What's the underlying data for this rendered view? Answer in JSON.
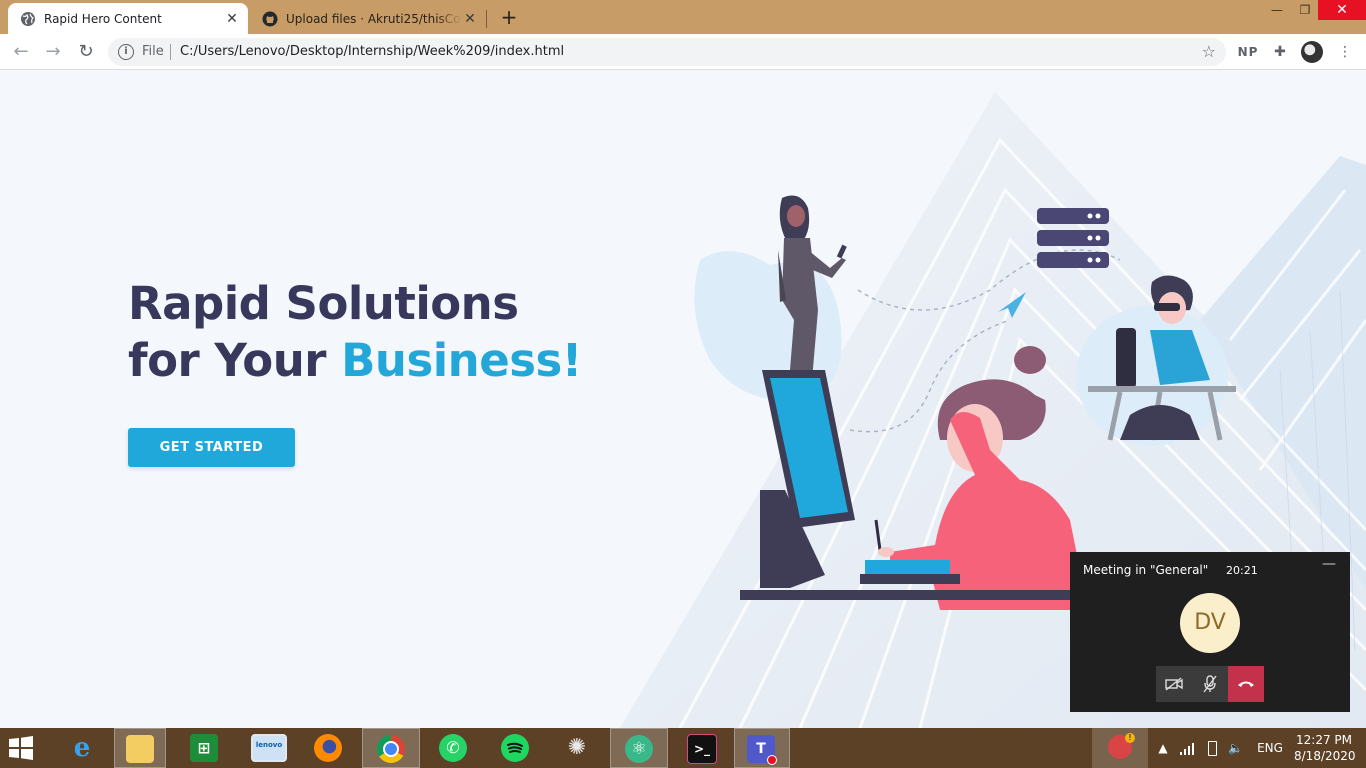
{
  "browser": {
    "tabs": [
      {
        "title": "Rapid Hero Content",
        "favicon": "globe-icon"
      },
      {
        "title": "Upload files · Akruti25/thisCourse",
        "favicon": "github-icon"
      }
    ],
    "new_tab": "+",
    "omnibox": {
      "scheme": "File",
      "url": "C:/Users/Lenovo/Desktop/Internship/Week%209/index.html"
    },
    "profile_initials": "NP"
  },
  "hero": {
    "title_line1": "Rapid Solutions",
    "title_line2_prefix": "for Your ",
    "title_line2_accent": "Business!",
    "cta_label": "GET STARTED"
  },
  "meeting": {
    "title": "Meeting in \"General\"",
    "timer": "20:21",
    "avatar_initials": "DV"
  },
  "taskbar": {
    "apps": [
      "internet-explorer",
      "file-explorer",
      "store",
      "lenovo",
      "firefox",
      "chrome",
      "whatsapp",
      "spotify",
      "web-app",
      "atom",
      "terminal",
      "teams"
    ],
    "language": "ENG",
    "time": "12:27 PM",
    "date": "8/18/2020"
  },
  "colors": {
    "tab_strip": "#c79c66",
    "heading": "#37385c",
    "accent": "#23a7d8",
    "button": "#1fa8d9",
    "taskbar": "#5c4126",
    "hangup": "#c4314b"
  }
}
